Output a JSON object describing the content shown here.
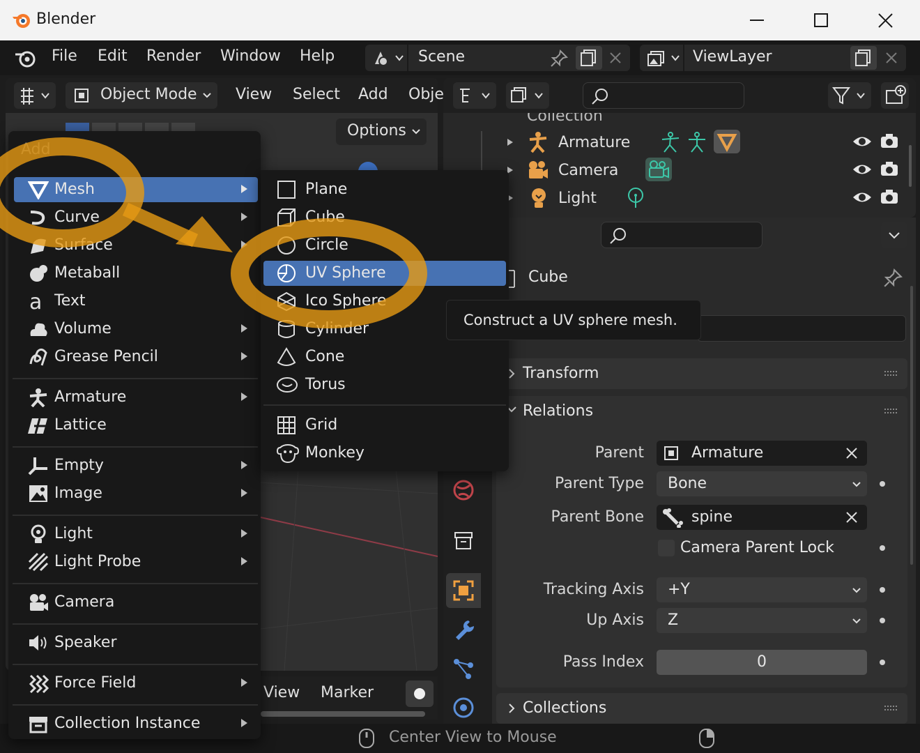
{
  "window": {
    "title": "Blender"
  },
  "topbar": {
    "menus": [
      "File",
      "Edit",
      "Render",
      "Window",
      "Help"
    ],
    "scene": "Scene",
    "view_layer": "ViewLayer"
  },
  "viewport_header": {
    "mode": "Object Mode",
    "menus": [
      "View",
      "Select",
      "Add",
      "Obje"
    ],
    "options": "Options"
  },
  "add_menu": {
    "title": "Add",
    "items": [
      {
        "label": "Mesh"
      },
      {
        "label": "Curve"
      },
      {
        "label": "Surface"
      },
      {
        "label": "Metaball"
      },
      {
        "label": "Text"
      },
      {
        "label": "Volume"
      },
      {
        "label": "Grease Pencil"
      },
      {
        "label": "Armature"
      },
      {
        "label": "Lattice"
      },
      {
        "label": "Empty"
      },
      {
        "label": "Image"
      },
      {
        "label": "Light"
      },
      {
        "label": "Light Probe"
      },
      {
        "label": "Camera"
      },
      {
        "label": "Speaker"
      },
      {
        "label": "Force Field"
      },
      {
        "label": "Collection Instance"
      }
    ]
  },
  "mesh_menu": {
    "items": [
      {
        "label": "Plane"
      },
      {
        "label": "Cube"
      },
      {
        "label": "Circle"
      },
      {
        "label": "UV Sphere"
      },
      {
        "label": "Ico Sphere"
      },
      {
        "label": "Cylinder"
      },
      {
        "label": "Cone"
      },
      {
        "label": "Torus"
      },
      {
        "label": "Grid"
      },
      {
        "label": "Monkey"
      }
    ]
  },
  "tooltip": "Construct a UV sphere mesh.",
  "outliner": {
    "collection": "Collection",
    "rows": [
      {
        "label": "Armature"
      },
      {
        "label": "Camera"
      },
      {
        "label": "Light"
      }
    ]
  },
  "properties": {
    "object_name": "Cube",
    "panels": {
      "transform": "Transform",
      "relations": "Relations",
      "collections": "Collections"
    },
    "relations": {
      "parent_label": "Parent",
      "parent_value": "Armature",
      "parent_type_label": "Parent Type",
      "parent_type_value": "Bone",
      "parent_bone_label": "Parent Bone",
      "parent_bone_value": "spine",
      "camera_parent_lock": "Camera Parent Lock",
      "tracking_axis_label": "Tracking Axis",
      "tracking_axis_value": "+Y",
      "up_axis_label": "Up Axis",
      "up_axis_value": "Z",
      "pass_index_label": "Pass Index",
      "pass_index_value": "0"
    }
  },
  "timeline": {
    "menus": [
      "View",
      "Marker"
    ]
  },
  "statusbar": {
    "hint": "Center View to Mouse"
  },
  "colors": {
    "accent": "#4772b3",
    "highlight_orange": "#e69a14",
    "teal": "#3cc7a8",
    "object_orange": "#e8a04a"
  }
}
